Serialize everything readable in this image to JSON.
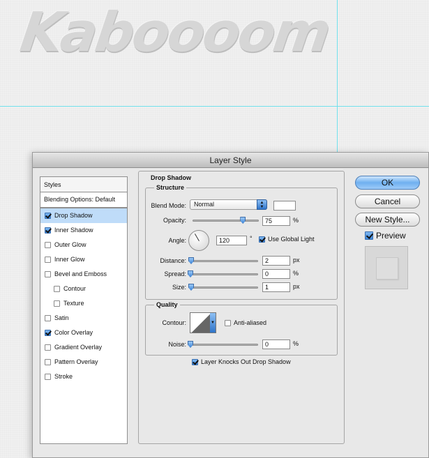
{
  "canvas": {
    "headline": "Kaboooom"
  },
  "dialog": {
    "title": "Layer Style",
    "styles": {
      "header": "Styles",
      "blending_options": "Blending Options: Default",
      "items": [
        {
          "label": "Drop Shadow",
          "checked": true,
          "selected": true,
          "indent": false
        },
        {
          "label": "Inner Shadow",
          "checked": true,
          "selected": false,
          "indent": false
        },
        {
          "label": "Outer Glow",
          "checked": false,
          "selected": false,
          "indent": false
        },
        {
          "label": "Inner Glow",
          "checked": false,
          "selected": false,
          "indent": false
        },
        {
          "label": "Bevel and Emboss",
          "checked": false,
          "selected": false,
          "indent": false
        },
        {
          "label": "Contour",
          "checked": false,
          "selected": false,
          "indent": true
        },
        {
          "label": "Texture",
          "checked": false,
          "selected": false,
          "indent": true
        },
        {
          "label": "Satin",
          "checked": false,
          "selected": false,
          "indent": false
        },
        {
          "label": "Color Overlay",
          "checked": true,
          "selected": false,
          "indent": false
        },
        {
          "label": "Gradient Overlay",
          "checked": false,
          "selected": false,
          "indent": false
        },
        {
          "label": "Pattern Overlay",
          "checked": false,
          "selected": false,
          "indent": false
        },
        {
          "label": "Stroke",
          "checked": false,
          "selected": false,
          "indent": false
        }
      ]
    },
    "drop_shadow": {
      "section_title": "Drop Shadow",
      "structure": {
        "title": "Structure",
        "blend_mode_label": "Blend Mode:",
        "blend_mode_value": "Normal",
        "shadow_color": "#ffffff",
        "opacity_label": "Opacity:",
        "opacity_value": "75",
        "opacity_slider": 0.75,
        "opacity_unit": "%",
        "angle_label": "Angle:",
        "angle_value": "120",
        "angle_unit": "°",
        "use_global_light_label": "Use Global Light",
        "use_global_light_checked": true,
        "distance_label": "Distance:",
        "distance_value": "2",
        "distance_unit": "px",
        "spread_label": "Spread:",
        "spread_value": "0",
        "spread_unit": "%",
        "size_label": "Size:",
        "size_value": "1",
        "size_unit": "px"
      },
      "quality": {
        "title": "Quality",
        "contour_label": "Contour:",
        "anti_aliased_label": "Anti-aliased",
        "anti_aliased_checked": false,
        "noise_label": "Noise:",
        "noise_value": "0",
        "noise_unit": "%"
      },
      "layer_knocks_out_label": "Layer Knocks Out Drop Shadow",
      "layer_knocks_out_checked": true
    },
    "buttons": {
      "ok": "OK",
      "cancel": "Cancel",
      "new_style": "New Style...",
      "preview_label": "Preview",
      "preview_checked": true
    }
  }
}
